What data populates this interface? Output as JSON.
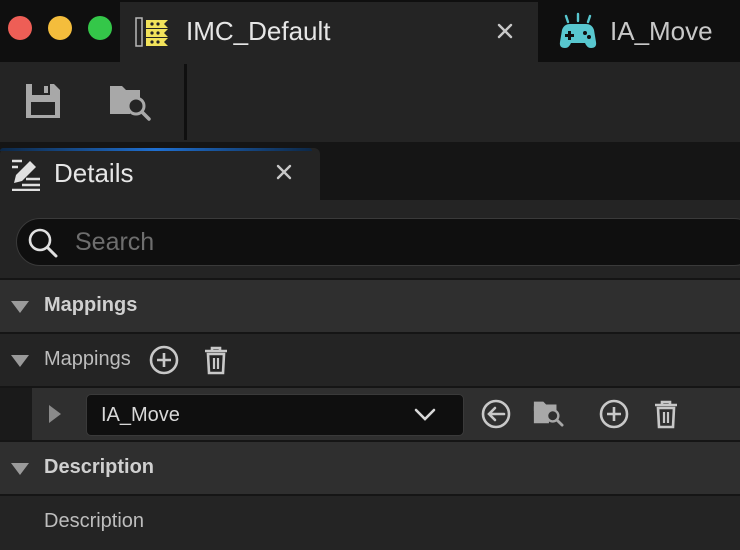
{
  "window": {
    "tabs": [
      {
        "label": "IMC_Default",
        "icon": "input-mapping-context-icon",
        "active": true
      },
      {
        "label": "IA_Move",
        "icon": "input-action-icon",
        "active": false
      }
    ]
  },
  "toolbar": {
    "save": "save-icon",
    "browse": "browse-to-asset-icon"
  },
  "panel": {
    "title": "Details"
  },
  "search": {
    "placeholder": "Search",
    "value": ""
  },
  "categories": {
    "mappings_header": "Mappings",
    "mappings_array_label": "Mappings",
    "description_header": "Description",
    "description_field": "Description"
  },
  "mapping_items": [
    {
      "action": "IA_Move"
    }
  ],
  "colors": {
    "accent_blue": "#1f6fd0",
    "imc_icon_yellow": "#f2e35b",
    "ia_icon_teal": "#58c7cf"
  }
}
